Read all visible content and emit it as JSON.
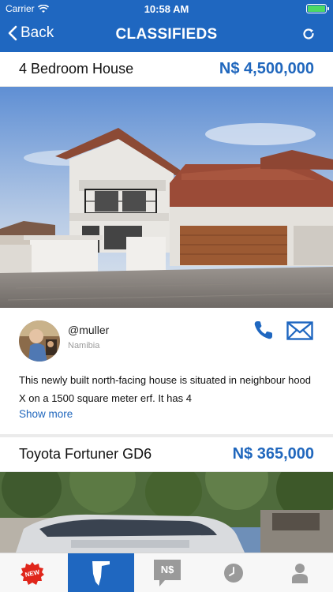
{
  "status_bar": {
    "carrier": "Carrier",
    "time": "10:58 AM"
  },
  "nav": {
    "back_label": "Back",
    "title": "CLASSIFIEDS"
  },
  "listings": [
    {
      "title": "4 Bedroom House",
      "price": "N$ 4,500,000",
      "seller_handle": "@muller",
      "seller_location": "Namibia",
      "description": "This newly built north-facing house is situated in neighbour hood X on a 1500 square meter erf. It has 4",
      "show_more": "Show more"
    },
    {
      "title": "Toyota Fortuner GD6",
      "price": "N$ 365,000"
    }
  ],
  "tabbar": {
    "new_badge": "NEW",
    "price_tab_glyph": "N$",
    "tabs": [
      "new-icon",
      "namibia-map-icon",
      "price-icon",
      "clock-icon",
      "profile-icon"
    ]
  },
  "colors": {
    "brand": "#1f67c0",
    "price": "#2067bd"
  }
}
